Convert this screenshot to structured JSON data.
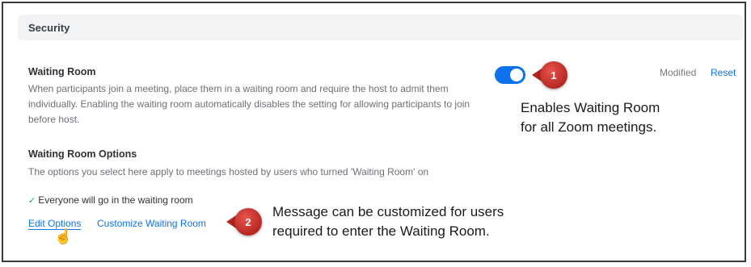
{
  "section": {
    "title": "Security"
  },
  "waiting_room": {
    "title": "Waiting Room",
    "description": "When participants join a meeting, place them in a waiting room and require the host to admit them individually. Enabling the waiting room automatically disables the setting for allowing participants to join before host.",
    "toggle_on": true,
    "status": "Modified",
    "reset_label": "Reset"
  },
  "options": {
    "title": "Waiting Room Options",
    "description": "The options you select here apply to meetings hosted by users who turned 'Waiting Room' on",
    "selected_option": "Everyone will go in the waiting room",
    "edit_label": "Edit Options",
    "customize_label": "Customize Waiting Room"
  },
  "callouts": [
    {
      "number": "1",
      "line1": "Enables Waiting Room",
      "line2": "for all Zoom meetings."
    },
    {
      "number": "2",
      "line1": "Message can be customized for users",
      "line2": "required to enter the Waiting Room."
    }
  ],
  "colors": {
    "accent": "#0e72ed",
    "badge": "#d23a34",
    "header_bg": "#f2f3f5",
    "check": "#2da44e"
  },
  "icons": {
    "check": "check-icon",
    "cursor": "hand-pointer-icon"
  }
}
